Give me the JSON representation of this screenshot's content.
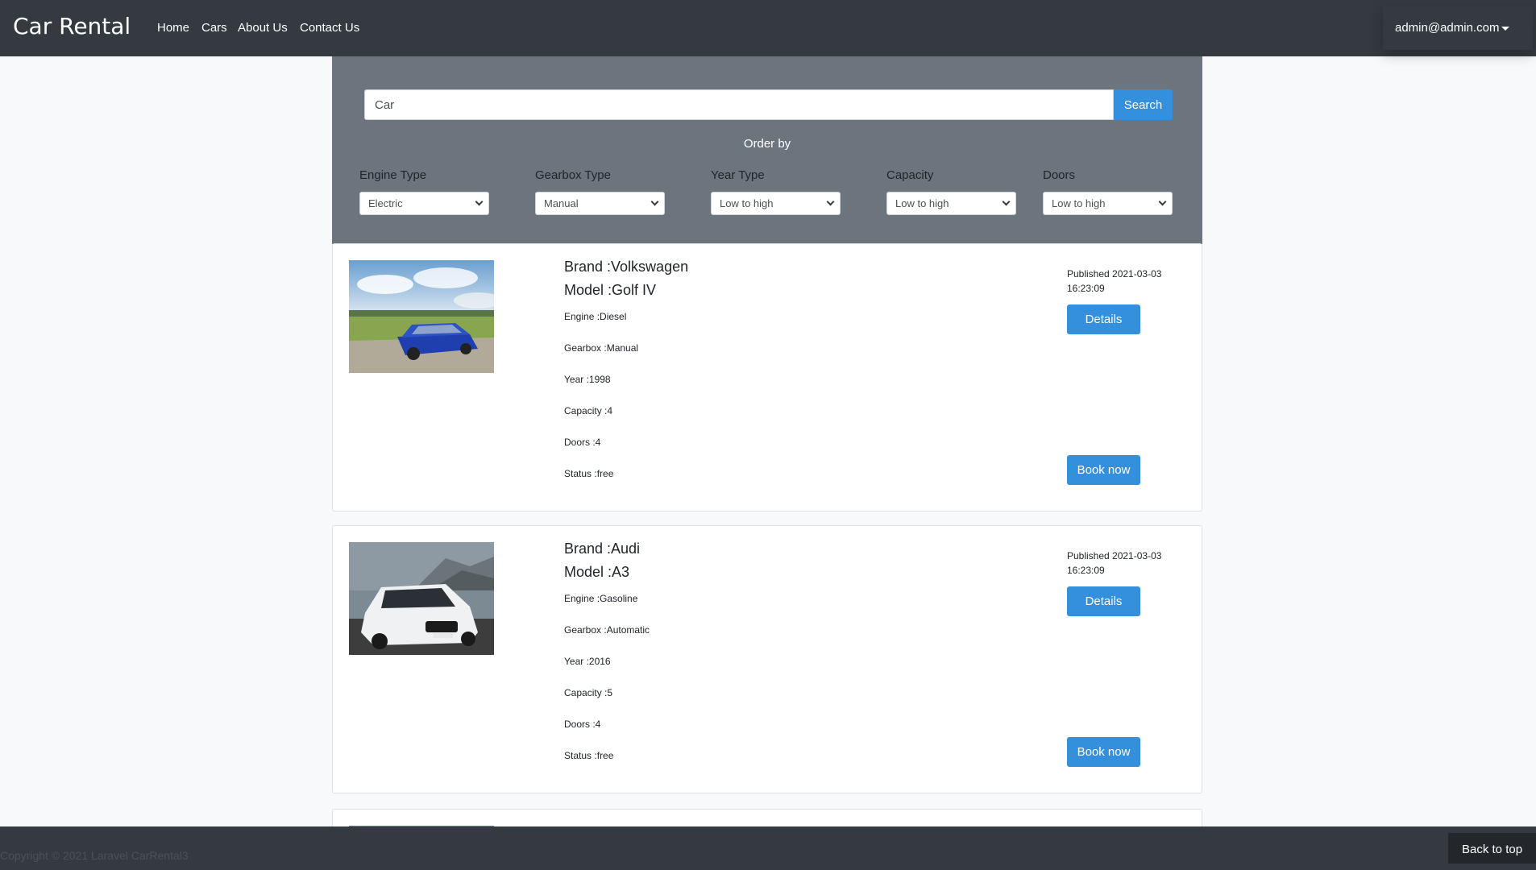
{
  "navbar": {
    "brand": "Car Rental",
    "links": [
      "Home",
      "Cars",
      "About Us",
      "Contact Us"
    ],
    "user": "admin@admin.com"
  },
  "search": {
    "value": "Car",
    "button_label": "Search"
  },
  "order": {
    "title": "Order by",
    "filters": [
      {
        "label": "Engine Type",
        "value": "Electric"
      },
      {
        "label": "Gearbox Type",
        "value": "Manual"
      },
      {
        "label": "Year Type",
        "value": "Low to high"
      },
      {
        "label": "Capacity",
        "value": "Low to high"
      },
      {
        "label": "Doors",
        "value": "Low to high"
      }
    ]
  },
  "cars": [
    {
      "brand": "Brand :Volkswagen",
      "model": "Model :Golf IV",
      "engine": "Engine :Diesel",
      "gearbox": "Gearbox :Manual",
      "year": "Year :1998",
      "capacity": "Capacity :4",
      "doors": "Doors :4",
      "status": "Status :free",
      "published": "Published 2021-03-03 16:23:09",
      "details_label": "Details",
      "book_label": "Book now"
    },
    {
      "brand": "Brand :Audi",
      "model": "Model :A3",
      "engine": "Engine :Gasoline",
      "gearbox": "Gearbox :Automatic",
      "year": "Year :2016",
      "capacity": "Capacity :5",
      "doors": "Doors :4",
      "status": "Status :free",
      "published": "Published 2021-03-03 16:23:09",
      "details_label": "Details",
      "book_label": "Book now"
    }
  ],
  "footer": {
    "copyright": "Copyright © 2021 Laravel CarRental3",
    "back_to_top": "Back to top"
  },
  "colors": {
    "navbar": "#343a40",
    "panel": "#6c757d",
    "primary": "#3490dc"
  }
}
